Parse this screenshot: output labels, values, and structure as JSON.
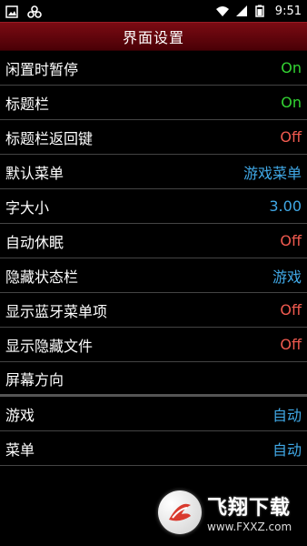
{
  "status_bar": {
    "time": "9:51"
  },
  "title": "界面设置",
  "colors": {
    "on": "#33d433",
    "off": "#f05a4f",
    "info": "#40a8e6"
  },
  "settings": [
    {
      "label": "闲置时暂停",
      "value": "On",
      "value_color": "#33d433"
    },
    {
      "label": "标题栏",
      "value": "On",
      "value_color": "#33d433"
    },
    {
      "label": "标题栏返回键",
      "value": "Off",
      "value_color": "#f05a4f"
    },
    {
      "label": "默认菜单",
      "value": "游戏菜单",
      "value_color": "#40a8e6"
    },
    {
      "label": "字大小",
      "value": "3.00",
      "value_color": "#40a8e6"
    },
    {
      "label": "自动休眠",
      "value": "Off",
      "value_color": "#f05a4f"
    },
    {
      "label": "隐藏状态栏",
      "value": "游戏",
      "value_color": "#40a8e6"
    },
    {
      "label": "显示蓝牙菜单项",
      "value": "Off",
      "value_color": "#f05a4f"
    },
    {
      "label": "显示隐藏文件",
      "value": "Off",
      "value_color": "#f05a4f"
    },
    {
      "label": "屏幕方向",
      "value": "",
      "value_color": "#40a8e6"
    },
    {
      "label": "游戏",
      "value": "自动",
      "value_color": "#40a8e6"
    },
    {
      "label": "菜单",
      "value": "自动",
      "value_color": "#40a8e6"
    }
  ],
  "watermark": {
    "main": "飞翔下载",
    "url": "www.FXXZ.com"
  }
}
